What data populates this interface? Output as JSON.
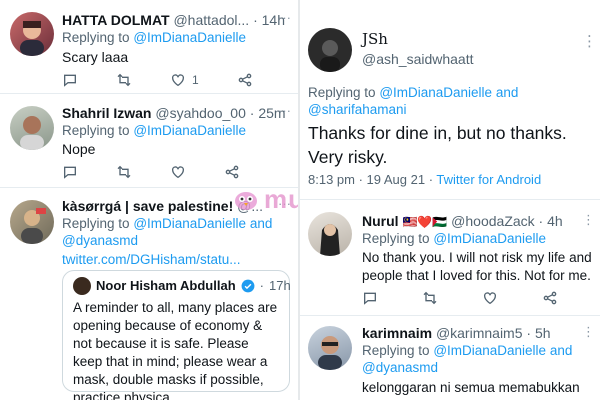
{
  "watermark": "murai",
  "left": {
    "tweets": [
      {
        "name": "HATTA DOLMAT",
        "handle": "@hattadol...",
        "time": "14h",
        "more": "···",
        "reply_prefix": "Replying to",
        "reply_to": "@ImDianaDanielle",
        "text": "Scary laaa",
        "like_count": "1"
      },
      {
        "name": "Shahril Izwan",
        "handle": "@syahdoo_00",
        "time": "25m",
        "more": "···",
        "reply_prefix": "Replying to",
        "reply_to": "@ImDianaDanielle",
        "text": "Nope"
      },
      {
        "name": "kàsørrgá | save palestine!",
        "handle": "@...",
        "more": "···",
        "reply_prefix": "Replying to",
        "reply_to": "@ImDianaDanielle and",
        "reply_to_2": "@dyanasmd",
        "link": "twitter.com/DGHisham/statu...",
        "quote": {
          "name": "Noor Hisham Abdullah",
          "time": "17h",
          "text": "A reminder to all, many places are opening because of economy & not because it is safe. Please keep that in mind; please wear a mask, double masks if possible, practice physica..."
        }
      }
    ]
  },
  "right": {
    "main": {
      "name": "JSh",
      "handle": "@ash_saidwhaatt",
      "more": "⋮",
      "reply_prefix": "Replying to",
      "reply_to": "@ImDianaDanielle and",
      "reply_to_2": "@sharifahamani",
      "text_line1": "Thanks for dine in, but no thanks.",
      "text_line2": "Very risky.",
      "timestamp": "8:13 pm · 19 Aug 21 · ",
      "source": "Twitter for Android"
    },
    "tweets": [
      {
        "name": "Nurul",
        "flags": "🇲🇾❤️🇵🇸",
        "handle": "@hoodaZack",
        "time": "4h",
        "more": "⋮",
        "reply_prefix": "Replying to",
        "reply_to": "@ImDianaDanielle",
        "text": "No thank you. I will not risk my life and people that I loved for this. Not for me."
      },
      {
        "name": "karimnaim",
        "handle": "@karimnaim5",
        "time": "5h",
        "more": "⋮",
        "reply_prefix": "Replying to",
        "reply_to": "@ImDianaDanielle and",
        "reply_to_2": "@dyanasmd",
        "text": "kelonggaran ni semua memabukkan"
      }
    ]
  },
  "colors": {
    "link": "#1d9bf0",
    "muted": "#536471",
    "text": "#0f1419",
    "verified": "#1d9bf0"
  }
}
